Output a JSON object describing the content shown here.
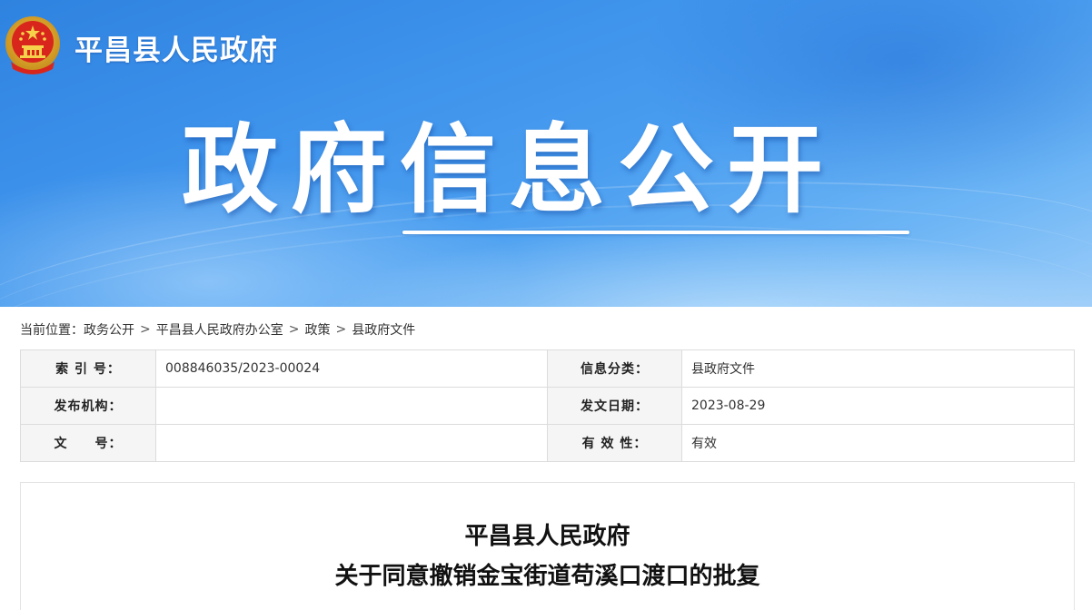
{
  "site": {
    "title": "平昌县人民政府"
  },
  "banner": {
    "heading": "政府信息公开"
  },
  "breadcrumb": {
    "prefix": "当前位置：",
    "items": [
      "政务公开",
      "平昌县人民政府办公室",
      "政策",
      "县政府文件"
    ],
    "separator": ">"
  },
  "meta": {
    "rows": [
      {
        "label1": "索 引 号：",
        "value1": "008846035/2023-00024",
        "label2": "信息分类：",
        "value2": "县政府文件"
      },
      {
        "label1": "发布机构：",
        "value1": "",
        "label2": "发文日期：",
        "value2": "2023-08-29"
      },
      {
        "label1": "文　　号：",
        "value1": "",
        "label2": "有 效 性：",
        "value2": "有效"
      }
    ]
  },
  "document": {
    "title_line1": "平昌县人民政府",
    "title_line2": "关于同意撤销金宝街道苟溪口渡口的批复"
  },
  "colors": {
    "banner": "#3a8fe9",
    "label_bg": "#f5f5f5",
    "border": "#dcdcdc"
  }
}
